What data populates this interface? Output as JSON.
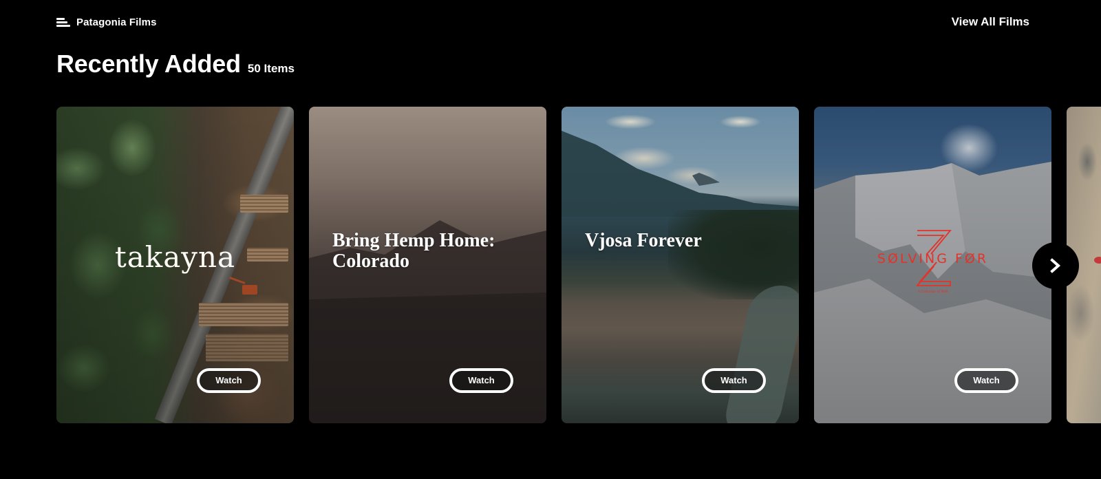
{
  "header": {
    "brand_name": "Patagonia Films",
    "brand_icon": "menu-lines-icon",
    "view_all_label": "View All Films"
  },
  "section": {
    "title": "Recently Added",
    "count": "50 Items"
  },
  "films": [
    {
      "title": "takayna",
      "watch_label": "Watch",
      "theme": "forest aerial with logging road"
    },
    {
      "title": "Bring Hemp Home: Colorado",
      "watch_label": "Watch",
      "theme": "dusky mountain silhouette"
    },
    {
      "title": "Vjosa Forever",
      "watch_label": "Watch",
      "theme": "river valley aerial"
    },
    {
      "title": "SØLVING FØR",
      "subtitle": "A Calculus of Risk",
      "watch_label": "Watch",
      "theme": "snowy mountain face",
      "logo_color": "#e2332a"
    },
    {
      "title": "",
      "theme": "climber on rock face (partially visible)"
    }
  ],
  "carousel": {
    "next_icon": "chevron-right-icon"
  },
  "colors": {
    "background": "#000000",
    "text": "#ffffff",
    "accent_red": "#e2332a"
  }
}
